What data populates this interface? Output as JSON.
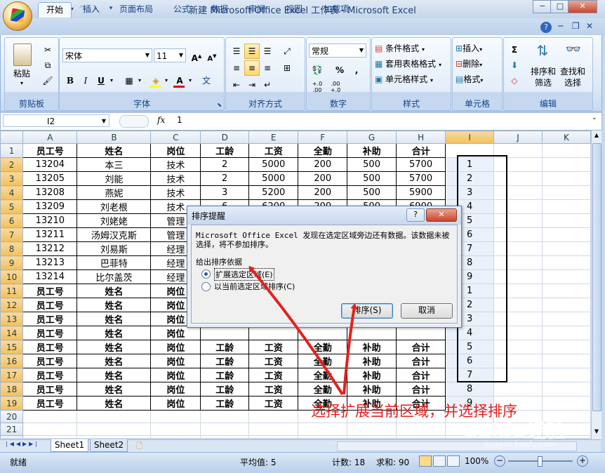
{
  "window": {
    "title": "新建 Microsoft Office Excel 工作表 - Microsoft Excel",
    "min": "−",
    "max": "□",
    "close": "✕"
  },
  "ribbon_tabs": [
    "开始",
    "插入",
    "页面布局",
    "公式",
    "数据",
    "审阅",
    "视图",
    "加载项"
  ],
  "ribbon": {
    "paste": "粘贴",
    "clipboard": "剪贴板",
    "font_name": "宋体",
    "font_size": "11",
    "bold": "B",
    "italic": "I",
    "underline": "U",
    "font_group": "字体",
    "align_group": "对齐方式",
    "number_format": "常规",
    "percent": "%",
    "comma": ",",
    "dec_inc": "+.0\n.00",
    "dec_dec": ".00\n+.0",
    "number_group": "数字",
    "cond_format": "条件格式",
    "table_format": "套用表格格式",
    "cell_style": "单元格样式",
    "style_group": "样式",
    "insert": "插入",
    "delete": "删除",
    "format": "格式",
    "cells_group": "单元格",
    "sort_filter": "排序和\n筛选",
    "find_select": "查找和\n选择",
    "edit_group": "编辑",
    "sum": "Σ"
  },
  "formula_bar": {
    "name_box": "I2",
    "fx": "fx",
    "value": "1"
  },
  "grid": {
    "columns": [
      "A",
      "B",
      "C",
      "D",
      "E",
      "F",
      "G",
      "H",
      "I",
      "J",
      "K"
    ],
    "rows": [
      [
        "员工号",
        "姓名",
        "岗位",
        "工龄",
        "工资",
        "全勤",
        "补助",
        "合计",
        ""
      ],
      [
        "13204",
        "本三",
        "技术",
        "2",
        "5000",
        "200",
        "500",
        "5700",
        "1"
      ],
      [
        "13205",
        "刘能",
        "技术",
        "2",
        "5000",
        "200",
        "500",
        "5700",
        "2"
      ],
      [
        "13208",
        "燕妮",
        "技术",
        "3",
        "5200",
        "200",
        "500",
        "5900",
        "3"
      ],
      [
        "13209",
        "刘老根",
        "技术",
        "6",
        "6200",
        "200",
        "500",
        "6900",
        "4"
      ],
      [
        "13210",
        "刘姥姥",
        "管理",
        "",
        "",
        "",
        "",
        "",
        "5"
      ],
      [
        "13211",
        "汤姆汉克斯",
        "管理",
        "",
        "",
        "",
        "",
        "",
        "6"
      ],
      [
        "13212",
        "刘易斯",
        "经理",
        "",
        "",
        "",
        "",
        "",
        "7"
      ],
      [
        "13213",
        "巴菲特",
        "经理",
        "",
        "",
        "",
        "",
        "",
        "8"
      ],
      [
        "13214",
        "比尔盖茨",
        "经理",
        "",
        "",
        "",
        "",
        "",
        "9"
      ],
      [
        "员工号",
        "姓名",
        "岗位",
        "",
        "",
        "",
        "",
        "",
        "1"
      ],
      [
        "员工号",
        "姓名",
        "岗位",
        "",
        "",
        "",
        "",
        "",
        "2"
      ],
      [
        "员工号",
        "姓名",
        "岗位",
        "",
        "",
        "",
        "",
        "",
        "3"
      ],
      [
        "员工号",
        "姓名",
        "岗位",
        "",
        "",
        "",
        "",
        "",
        "4"
      ],
      [
        "员工号",
        "姓名",
        "岗位",
        "工龄",
        "工资",
        "全勤",
        "补助",
        "合计",
        "5"
      ],
      [
        "员工号",
        "姓名",
        "岗位",
        "工龄",
        "工资",
        "全勤",
        "补助",
        "合计",
        "6"
      ],
      [
        "员工号",
        "姓名",
        "岗位",
        "工龄",
        "工资",
        "全勤",
        "补助",
        "合计",
        "7"
      ],
      [
        "员工号",
        "姓名",
        "岗位",
        "工龄",
        "工资",
        "全勤",
        "补助",
        "合计",
        "8"
      ],
      [
        "员工号",
        "姓名",
        "岗位",
        "工龄",
        "工资",
        "全勤",
        "补助",
        "合计",
        "9"
      ],
      [
        "",
        "",
        "",
        "",
        "",
        "",
        "",
        "",
        ""
      ],
      [
        "",
        "",
        "",
        "",
        "",
        "",
        "",
        "",
        ""
      ],
      [
        "",
        "",
        "",
        "",
        "",
        "",
        "",
        "",
        ""
      ],
      [
        "",
        "",
        "",
        "",
        "",
        "",
        "",
        "",
        ""
      ],
      [
        "",
        "",
        "",
        "",
        "",
        "",
        "",
        "",
        ""
      ]
    ]
  },
  "sheets": [
    "Sheet1",
    "Sheet2"
  ],
  "status": {
    "ready": "就绪",
    "average": "平均值: 5",
    "count": "计数: 18",
    "sum": "求和: 90",
    "zoom": "100%"
  },
  "dialog": {
    "title": "排序提醒",
    "help": "?",
    "close": "✕",
    "message": "Microsoft Office Excel 发现在选定区域旁边还有数据。该数据未被选择，将不参加排序。",
    "group_label": "给出排序依据",
    "option1": "扩展选定区域(E)",
    "option2": "以当前选定区域排序(C)",
    "ok": "排序(S)",
    "cancel": "取消"
  },
  "annotation": "选择扩展当前区域，并选择排序",
  "watermark": "Baidu经验",
  "watermark_sub": "jingyan.baidu.com",
  "colors": {
    "arrow": "#e3211c",
    "ribbon_accent": "#15428b"
  }
}
